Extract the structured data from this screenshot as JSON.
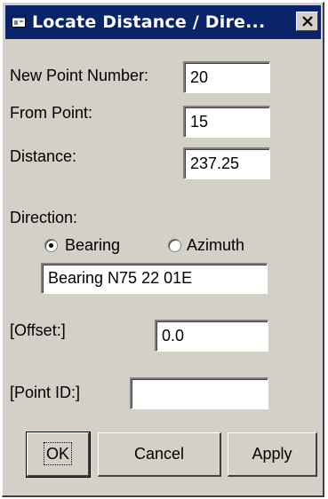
{
  "window": {
    "title": "Locate Distance / Dire...",
    "close_label": "X"
  },
  "fields": {
    "new_point_label": "New Point Number:",
    "new_point_value": "20",
    "from_point_label": "From Point:",
    "from_point_value": "15",
    "distance_label": "Distance:",
    "distance_value": "237.25",
    "direction_label": "Direction:",
    "direction_value": "Bearing N75 22 01E",
    "offset_label": "[Offset:]",
    "offset_value": "0.0",
    "point_id_label": "[Point ID:]",
    "point_id_value": ""
  },
  "direction_options": {
    "bearing_label": "Bearing",
    "azimuth_label": "Azimuth",
    "selected": "Bearing"
  },
  "buttons": {
    "ok": "OK",
    "cancel": "Cancel",
    "apply": "Apply"
  },
  "colors": {
    "titlebar": "#0a246a",
    "face": "#d4d0c8"
  },
  "icons": {
    "title": "app-window-icon",
    "close": "close-icon"
  }
}
